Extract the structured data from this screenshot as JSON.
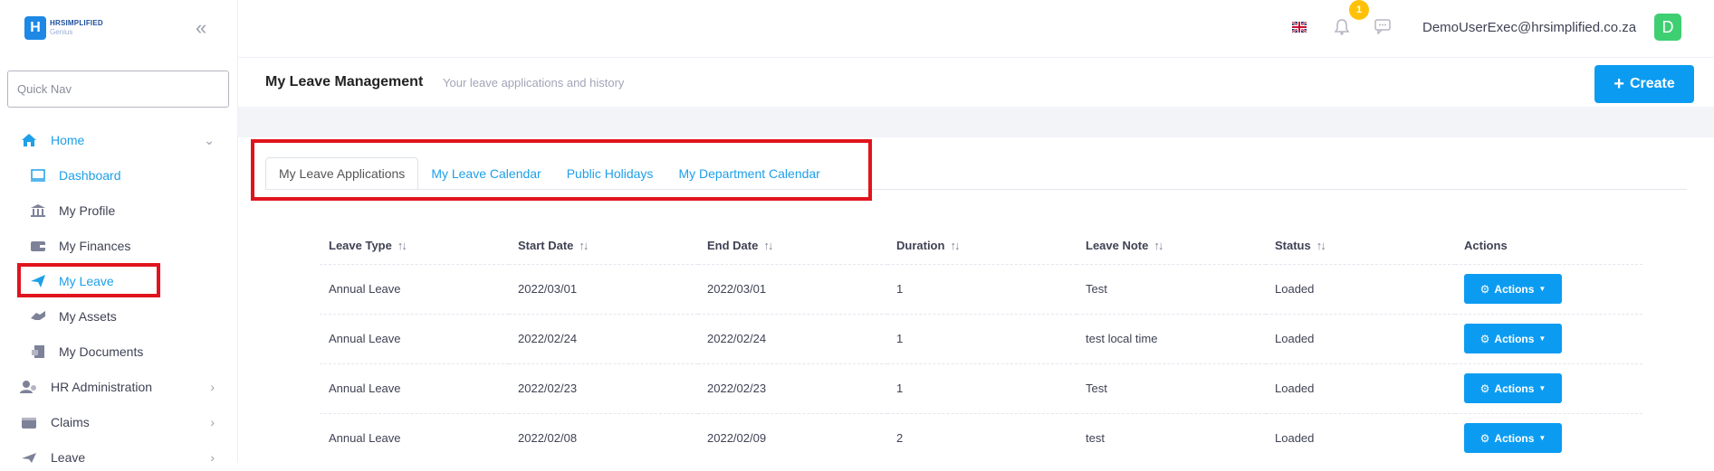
{
  "app": {
    "logo_title": "HRSIMPLIFIED",
    "logo_sub": "Genius",
    "logo_letter": "H"
  },
  "sidebar": {
    "quick_nav_placeholder": "Quick Nav",
    "collapse_glyph": "«",
    "items": [
      {
        "label": "Home",
        "icon": "home-icon"
      },
      {
        "label": "Dashboard",
        "icon": "dashboard-icon"
      },
      {
        "label": "My Profile",
        "icon": "bank-icon"
      },
      {
        "label": "My Finances",
        "icon": "wallet-icon"
      },
      {
        "label": "My Leave",
        "icon": "paper-plane-icon"
      },
      {
        "label": "My Assets",
        "icon": "assets-icon"
      },
      {
        "label": "My Documents",
        "icon": "documents-icon"
      },
      {
        "label": "HR Administration",
        "icon": "users-icon"
      },
      {
        "label": "Claims",
        "icon": "claims-icon"
      },
      {
        "label": "Leave",
        "icon": "plane-icon"
      }
    ]
  },
  "topbar": {
    "notification_count": "1",
    "user_email": "DemoUserExec@hrsimplified.co.za",
    "avatar_letter": "D"
  },
  "subheader": {
    "title": "My Leave Management",
    "description": "Your leave applications and history",
    "create_label": "Create"
  },
  "tabs": [
    {
      "label": "My Leave Applications"
    },
    {
      "label": "My Leave Calendar"
    },
    {
      "label": "Public Holidays"
    },
    {
      "label": "My Department Calendar"
    }
  ],
  "table": {
    "sort_glyph": "↑↓",
    "headers": [
      "Leave Type",
      "Start Date",
      "End Date",
      "Duration",
      "Leave Note",
      "Status",
      "Actions"
    ],
    "action_label": "Actions",
    "rows": [
      [
        "Annual Leave",
        "2022/03/01",
        "2022/03/01",
        "1",
        "Test",
        "Loaded"
      ],
      [
        "Annual Leave",
        "2022/02/24",
        "2022/02/24",
        "1",
        "test local time",
        "Loaded"
      ],
      [
        "Annual Leave",
        "2022/02/23",
        "2022/02/23",
        "1",
        "Test",
        "Loaded"
      ],
      [
        "Annual Leave",
        "2022/02/08",
        "2022/02/09",
        "2",
        "test",
        "Loaded"
      ]
    ]
  },
  "colors": {
    "accent": "#0b9cf2",
    "active_link": "#1e9fe8",
    "highlight": "#e0141e",
    "avatar": "#3ecf72",
    "badge": "#ffc107"
  }
}
